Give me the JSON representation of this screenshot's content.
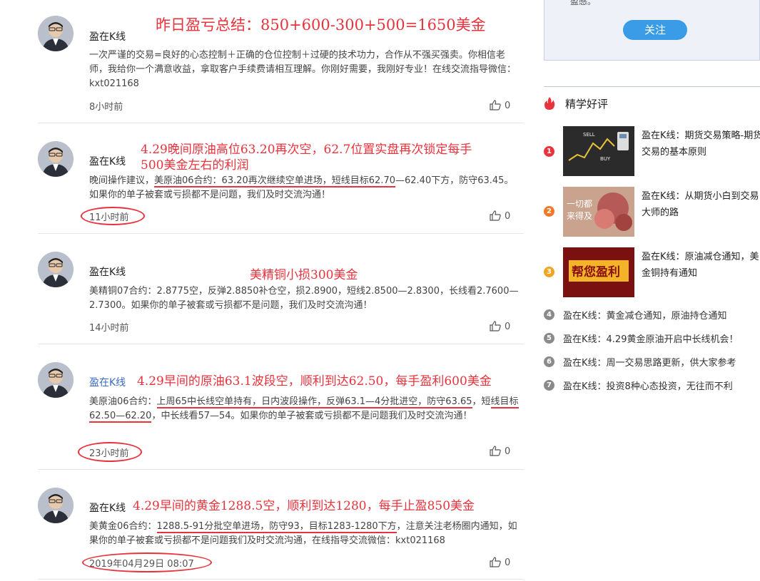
{
  "feed": {
    "posts": [
      {
        "author": "盈在K线",
        "annotation": "昨日盈亏总结：850+600-300+500=1650美金",
        "body": "一次严谨的交易=良好的心态控制＋正确的仓位控制＋过硬的技术功力，合作从不强买强卖。你相信老师，我给你一个满意收益，拿取客户手续费请相互理解。你刚好需要，我刚好专业！在线交流指导微信：kxt021168",
        "time": "8小时前",
        "likes": "0"
      },
      {
        "author": "盈在K线",
        "annotation_line1": "4.29晚间原油高位63.20再次空，62.7位置实盘再次锁定每手",
        "annotation_line2": "500美金左右的利润",
        "body_prefix": "晚间操作建议，",
        "body_underlined": "美原油06合约：63.20再次继续空单进场，短线目标62.70",
        "body_rest": "—62.40下方，防守63.45。如果你的单子被套或亏损都不是问题，我们及时交流沟通！",
        "time": "11小时前",
        "likes": "0"
      },
      {
        "author": "盈在K线",
        "annotation": "美精铜小损300美金",
        "body": "美精铜07合约：2.8775空，反弹2.8850补仓空，损2.8900，短线2.8500—2.8300，长线看2.7600—2.7300。如果你的单子被套或亏损都不是问题，我们及时交流沟通！",
        "time": "14小时前",
        "likes": "0"
      },
      {
        "author": "盈在K线",
        "annotation": "4.29早间的原油63.1波段空，顺利到达62.50，每手盈利600美金",
        "body_prefix": "美原油06合约：",
        "body_underlined": "上周65中长线空单持有，日内波段操作，反弹63.1—4分批进空，防守63.65",
        "body_mid": "，短",
        "body_underlined2": "线目标62.50—62.20",
        "body_rest": "，中长线看57—54。如果你的单子被套或亏损都不是问题我们及时交流沟通！",
        "time": "23小时前",
        "likes": "0"
      },
      {
        "author": "盈在K线",
        "annotation": "4.29早间的黄金1288.5空，顺利到达1280，每手止盈850美金",
        "body_prefix": "美黄金06合约：",
        "body_underlined": "1288.5-91分批空单进场，防守93，目标1283-1280下方",
        "body_rest": "，注意关注老杨圈内通知，如果你的单子被套或亏损都不是问题我们及时交流沟通，在线指导交流微信：kxt021168",
        "time": "2019年04月29日 08:07",
        "likes": "0"
      }
    ]
  },
  "sidebar": {
    "follow_cut_text": "盈感。",
    "follow_button": "关注",
    "section_title": "精学好评",
    "thumb_items": [
      {
        "rank": "1",
        "title": "盈在K线：期货交易策略-期货交易的基本原则",
        "thumb_caption_a": "SELL",
        "thumb_caption_b": "BUY",
        "color": "#e8323c"
      },
      {
        "rank": "2",
        "title": "盈在K线：从期货小白到交易大师的路",
        "thumb_caption_a": "一切都",
        "thumb_caption_b": "来得及",
        "color": "#f07a2a"
      },
      {
        "rank": "3",
        "title": "盈在K线：原油减仓通知，美金铜持有通知",
        "thumb_caption_a": "帮您盈利",
        "color": "#f0a422"
      }
    ],
    "text_items": [
      {
        "rank": "4",
        "title": "盈在K线：黄金减仓通知，原油持仓通知"
      },
      {
        "rank": "5",
        "title": "盈在K线：4.29黄金原油开启中长线机会！"
      },
      {
        "rank": "6",
        "title": "盈在K线：周一交易思路更新，供大家参考"
      },
      {
        "rank": "7",
        "title": "盈在K线：投资8种心态投资，无往而不利"
      }
    ]
  }
}
